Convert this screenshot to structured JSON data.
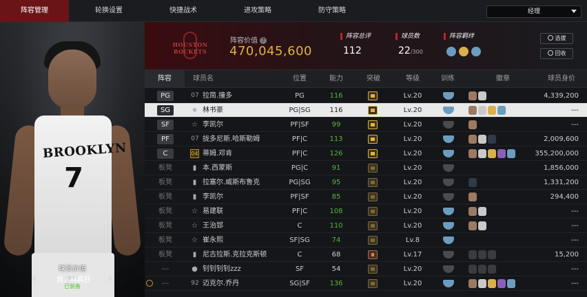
{
  "tabs": [
    {
      "label": "阵容管理",
      "active": true
    },
    {
      "label": "轮换设置",
      "active": false
    },
    {
      "label": "快捷战术",
      "active": false
    },
    {
      "label": "进攻策略",
      "active": false
    },
    {
      "label": "防守策略",
      "active": false
    }
  ],
  "role_select": {
    "value": "经理"
  },
  "player": {
    "jersey_text": "BROOKLYN",
    "jersey_number": "7",
    "value_label": "球员价值",
    "value": "---",
    "nickname": "我，林疯狂",
    "status": "已装备"
  },
  "team": {
    "logo_text": "HOUSTON ROCKETS",
    "lineup_value_label": "阵容价值",
    "lineup_value": "470,045,600",
    "rating_label": "阵容总评",
    "rating": "112",
    "count_label": "球员数",
    "count": "22",
    "count_max": "/300",
    "synergy_label": "阵容羁绊",
    "select_btn": "选拔",
    "recycle_btn": "回收"
  },
  "table": {
    "headers": [
      "阵容",
      "球员名",
      "位置",
      "能力",
      "突破",
      "等级",
      "训练",
      "徽章",
      "球员身价"
    ],
    "rows": [
      {
        "slot": "PG",
        "bench": false,
        "num": "07",
        "numtype": "text",
        "name": "拉简.撞多",
        "pos": "PG",
        "ability": "116",
        "green": true,
        "breakout": "gold",
        "level": "Lv.20",
        "train": "blue",
        "badges": [
          "bronze",
          "silver"
        ],
        "price": "4,339,200",
        "selected": false
      },
      {
        "slot": "SG",
        "bench": false,
        "num": "★",
        "numtype": "icon",
        "name": "林书豪",
        "pos": "PG|SG",
        "ability": "116",
        "green": true,
        "breakout": "gold",
        "level": "Lv.20",
        "train": "blue",
        "badges": [
          "bronze",
          "silver",
          "gold",
          "blue"
        ],
        "price": "---",
        "selected": true
      },
      {
        "slot": "SF",
        "bench": false,
        "num": "☆",
        "numtype": "icon",
        "name": "李凯尔",
        "pos": "PF|SF",
        "ability": "99",
        "green": true,
        "breakout": "gold",
        "level": "Lv.20",
        "train": "gray",
        "badges": [
          "bronze"
        ],
        "price": "---",
        "selected": false
      },
      {
        "slot": "PF",
        "bench": false,
        "num": "07",
        "numtype": "text",
        "name": "拢多尼斯.哈斯勒姆",
        "pos": "PF|C",
        "ability": "113",
        "green": true,
        "breakout": "gold",
        "level": "Lv.20",
        "train": "blue",
        "badges": [
          "bronze",
          "silver",
          "navy"
        ],
        "price": "2,009,600",
        "selected": false
      },
      {
        "slot": "C",
        "bench": false,
        "num": "04",
        "numtype": "gold",
        "name": "蒂姆.邓肯",
        "pos": "PF|C",
        "ability": "126",
        "green": true,
        "breakout": "gold",
        "level": "Lv.20",
        "train": "blue",
        "badges": [
          "bronze",
          "silver",
          "gold",
          "purple",
          "blue"
        ],
        "price": "355,200,000",
        "selected": false
      },
      {
        "slot": "板凳",
        "bench": true,
        "num": "▮",
        "numtype": "icon",
        "name": "本.西蒙斯",
        "pos": "PG|C",
        "ability": "91",
        "green": true,
        "breakout": "dim",
        "level": "Lv.20",
        "train": "gray",
        "badges": [],
        "price": "1,856,000",
        "selected": false
      },
      {
        "slot": "板凳",
        "bench": true,
        "num": "▮",
        "numtype": "icon",
        "name": "拉塞尔.威斯布鲁克",
        "pos": "PG|SG",
        "ability": "95",
        "green": true,
        "breakout": "dim",
        "level": "Lv.20",
        "train": "gray",
        "badges": [
          "navy"
        ],
        "price": "1,331,200",
        "selected": false
      },
      {
        "slot": "板凳",
        "bench": true,
        "num": "▮",
        "numtype": "icon",
        "name": "李凯尔",
        "pos": "PF|SF",
        "ability": "85",
        "green": true,
        "breakout": "dim",
        "level": "Lv.20",
        "train": "gray",
        "badges": [
          "bronze"
        ],
        "price": "294,400",
        "selected": false
      },
      {
        "slot": "板凳",
        "bench": true,
        "num": "☆",
        "numtype": "icon",
        "name": "易建联",
        "pos": "PF|C",
        "ability": "108",
        "green": true,
        "breakout": "dim",
        "level": "Lv.20",
        "train": "blue",
        "badges": [
          "bronze",
          "silver"
        ],
        "price": "---",
        "selected": false
      },
      {
        "slot": "板凳",
        "bench": true,
        "num": "☆",
        "numtype": "icon",
        "name": "王治郅",
        "pos": "C",
        "ability": "110",
        "green": true,
        "breakout": "dim",
        "level": "Lv.20",
        "train": "blue",
        "badges": [
          "bronze",
          "silver"
        ],
        "price": "---",
        "selected": false
      },
      {
        "slot": "板凳",
        "bench": true,
        "num": "☆",
        "numtype": "icon",
        "name": "崔永熙",
        "pos": "SF|SG",
        "ability": "74",
        "green": true,
        "breakout": "dim",
        "level": "Lv.8",
        "train": "blue",
        "badges": [],
        "price": "---",
        "selected": false
      },
      {
        "slot": "板凳",
        "bench": true,
        "num": "▮",
        "numtype": "icon",
        "name": "尼古拉斯.克拉克斯顿",
        "pos": "C",
        "ability": "68",
        "green": false,
        "breakout": "copper",
        "level": "Lv.17",
        "train": "gray",
        "badges": [
          "dark",
          "dark",
          "dark"
        ],
        "price": "15,200",
        "selected": false
      },
      {
        "slot": "---",
        "bench": true,
        "num": "●",
        "numtype": "icon",
        "name": "钊钊钊钊zzz",
        "pos": "SF",
        "ability": "54",
        "green": false,
        "breakout": "dim",
        "level": "Lv.20",
        "train": "gray",
        "badges": [
          "dark",
          "dark",
          "dark"
        ],
        "price": "---",
        "selected": false
      },
      {
        "slot": "---",
        "bench": true,
        "num": "92",
        "numtype": "text",
        "name": "迈克尔.乔丹",
        "pos": "SG|SF",
        "ability": "136",
        "green": true,
        "breakout": "dim",
        "level": "Lv.20",
        "train": "blue",
        "badges": [
          "bronze",
          "silver",
          "gold",
          "purple",
          "blue"
        ],
        "price": "---",
        "selected": false,
        "alarm": true
      }
    ]
  }
}
